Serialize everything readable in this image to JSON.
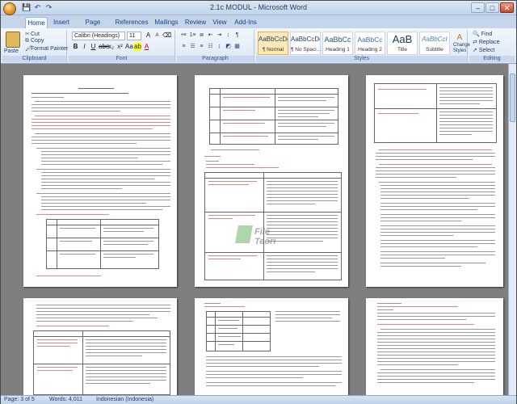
{
  "window": {
    "title": "2.1c MODUL - Microsoft Word"
  },
  "qat": {
    "save_glyph": "💾",
    "undo_glyph": "↶",
    "redo_glyph": "↷"
  },
  "controls": {
    "minimize": "–",
    "maximize": "□",
    "close": "✕"
  },
  "tabs": [
    {
      "label": "Home"
    },
    {
      "label": "Insert"
    },
    {
      "label": "Page Layout"
    },
    {
      "label": "References"
    },
    {
      "label": "Mailings"
    },
    {
      "label": "Review"
    },
    {
      "label": "View"
    },
    {
      "label": "Add-Ins"
    }
  ],
  "clipboard": {
    "paste": "Paste",
    "cut": "Cut",
    "copy": "Copy",
    "format_painter": "Format Painter",
    "label": "Clipboard"
  },
  "font": {
    "name": "Calibri (Headings)",
    "size": "11",
    "label": "Font"
  },
  "paragraph": {
    "label": "Paragraph"
  },
  "styles": {
    "label": "Styles",
    "items": [
      {
        "sample": "AaBbCcDd",
        "name": "¶ Normal"
      },
      {
        "sample": "AaBbCcDd",
        "name": "¶ No Spaci..."
      },
      {
        "sample": "AaBbCc",
        "name": "Heading 1"
      },
      {
        "sample": "AaBbCc",
        "name": "Heading 2"
      },
      {
        "sample": "AaB",
        "name": "Title"
      },
      {
        "sample": "AaBbCcI",
        "name": "Subtitle"
      }
    ],
    "change_styles": "Change Styles"
  },
  "editing": {
    "find": "Find",
    "replace": "Replace",
    "select": "Select",
    "label": "Editing"
  },
  "watermark": {
    "text": "File Teori"
  },
  "status": {
    "page": "Page: 3 of 5",
    "words": "Words: 4,011",
    "language": "Indonesian (Indonesia)"
  },
  "colors": {
    "accent": "#15428b",
    "ribbon": "#dbe7f6",
    "workspace": "#7f7f7f"
  }
}
